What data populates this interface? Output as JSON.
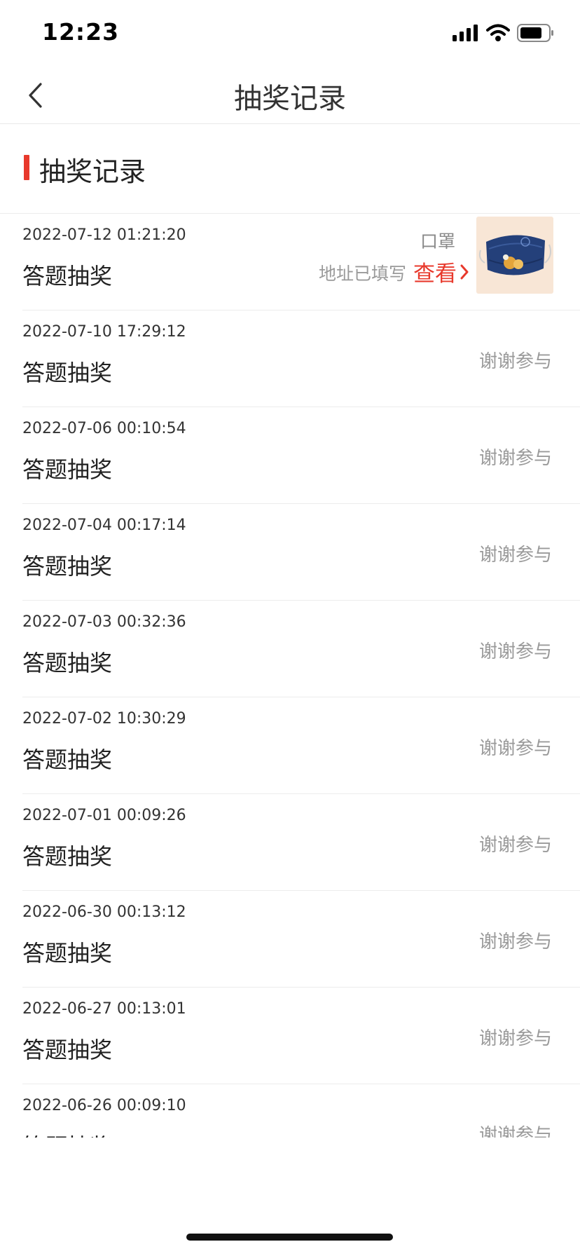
{
  "status_bar": {
    "time": "12:23"
  },
  "nav": {
    "title": "抽奖记录"
  },
  "section": {
    "title": "抽奖记录"
  },
  "records": [
    {
      "time": "2022-07-12 01:21:20",
      "type": "答题抽奖",
      "prize": "口罩",
      "address_status": "地址已填写",
      "view_label": "查看",
      "prize_image": "mask-image"
    },
    {
      "time": "2022-07-10 17:29:12",
      "type": "答题抽奖",
      "result": "谢谢参与"
    },
    {
      "time": "2022-07-06 00:10:54",
      "type": "答题抽奖",
      "result": "谢谢参与"
    },
    {
      "time": "2022-07-04 00:17:14",
      "type": "答题抽奖",
      "result": "谢谢参与"
    },
    {
      "time": "2022-07-03 00:32:36",
      "type": "答题抽奖",
      "result": "谢谢参与"
    },
    {
      "time": "2022-07-02 10:30:29",
      "type": "答题抽奖",
      "result": "谢谢参与"
    },
    {
      "time": "2022-07-01 00:09:26",
      "type": "答题抽奖",
      "result": "谢谢参与"
    },
    {
      "time": "2022-06-30 00:13:12",
      "type": "答题抽奖",
      "result": "谢谢参与"
    },
    {
      "time": "2022-06-27 00:13:01",
      "type": "答题抽奖",
      "result": "谢谢参与"
    },
    {
      "time": "2022-06-26 00:09:10",
      "type": "答题抽奖",
      "result": "谢谢参与"
    }
  ],
  "colors": {
    "accent": "#e8392c",
    "muted": "#9a9a9a"
  },
  "icons": {
    "back": "chevron-left-icon",
    "signal": "cellular-signal-icon",
    "wifi": "wifi-icon",
    "battery": "battery-icon"
  }
}
